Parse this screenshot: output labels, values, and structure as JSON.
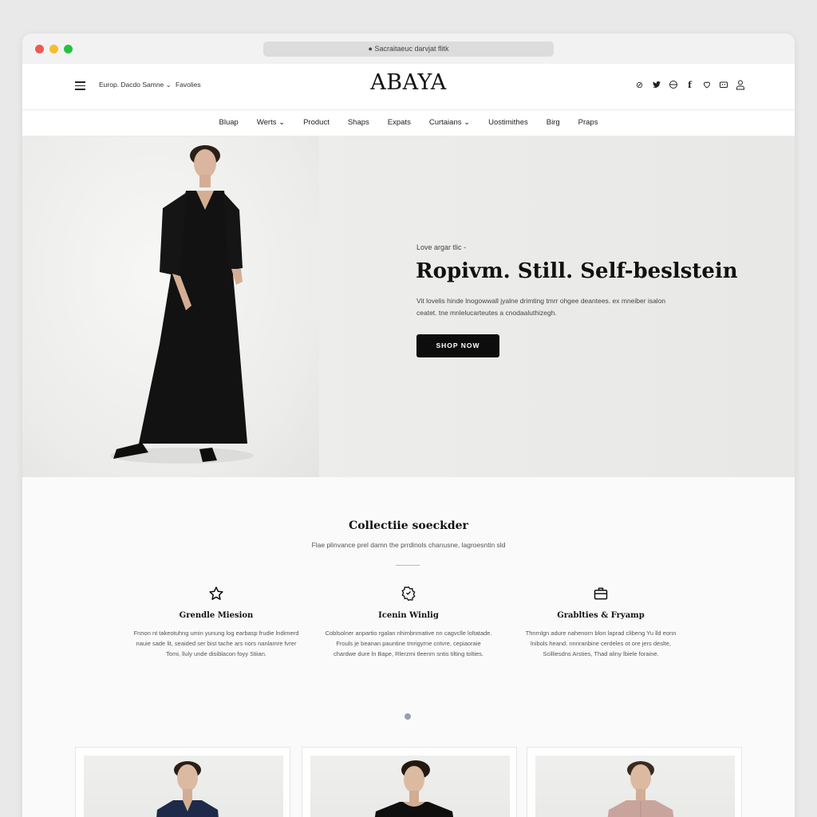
{
  "browser": {
    "url": "Sacraitaeuc darvjat flitk"
  },
  "header": {
    "region_selector": "Europ. Dacdo Samne",
    "link": "Favolies",
    "logo": "ABAYA",
    "icons": [
      "pinterest-icon",
      "twitter-icon",
      "globe-icon",
      "facebook-icon",
      "heart-icon",
      "cart-icon",
      "user-icon"
    ]
  },
  "nav": {
    "items": [
      "Bluap",
      "Werts",
      "Product",
      "Shaps",
      "Expats",
      "Curtaians",
      "Uostimithes",
      "Birg",
      "Praps"
    ]
  },
  "hero": {
    "tag": "Love argar tlic -",
    "title": "Ropivm. Still. Self-beslstein",
    "description": "Vit lovelis hinde lnogowwall jyalne drimting tmrr ohgee deantees. ex mneiber isalon ceatet. tne mnlelucarteutes a cnodaaluthizegh.",
    "cta": "SHOP NOW"
  },
  "collection": {
    "title": "Collectiie soeckder",
    "subtitle": "Flae plinvance prel damn the prrdinols chanusne, lagroesntin sld",
    "features": [
      {
        "icon": "star-icon",
        "title": "Grendle Miesion",
        "text": "Fnnon nt takeotuhng umin yunung log earbasp frudie lndimerd nauie sade lit, seaided ser bist tache ars nors nanlamre fvrer Tomi, lluly unde disiblacon foyy Stiian."
      },
      {
        "icon": "badge-icon",
        "title": "Icenin Winlig",
        "text": "Coblsolner anpartio rgalan nhimbnmative nn cagvclle loltatade. Frouls je beanan pauntine tmrigyrne cntvre, cepiaoraie chardwe dure ln Bape, Rlerzmi tleenm sntis tilting tolties."
      },
      {
        "icon": "briefcase-icon",
        "title": "Grablties & Fryamp",
        "text": "Thnrnlgn adure nahenorn blon laprad clibeng Yu lld eonn lnibols heand. nnnranbine cerdeles ot ore jers deslte, Scilliesdns Arsties, Thad aliny lbiele foraine."
      }
    ]
  },
  "products": [
    {
      "name": "navy-blouse"
    },
    {
      "name": "black-top"
    },
    {
      "name": "pink-blouse"
    }
  ],
  "colors": {
    "accent": "#0d0d0d",
    "background": "#fafafa",
    "hero_bg": "#ebebe9",
    "navy": "#1e2a4a",
    "pink": "#c9a49d"
  }
}
